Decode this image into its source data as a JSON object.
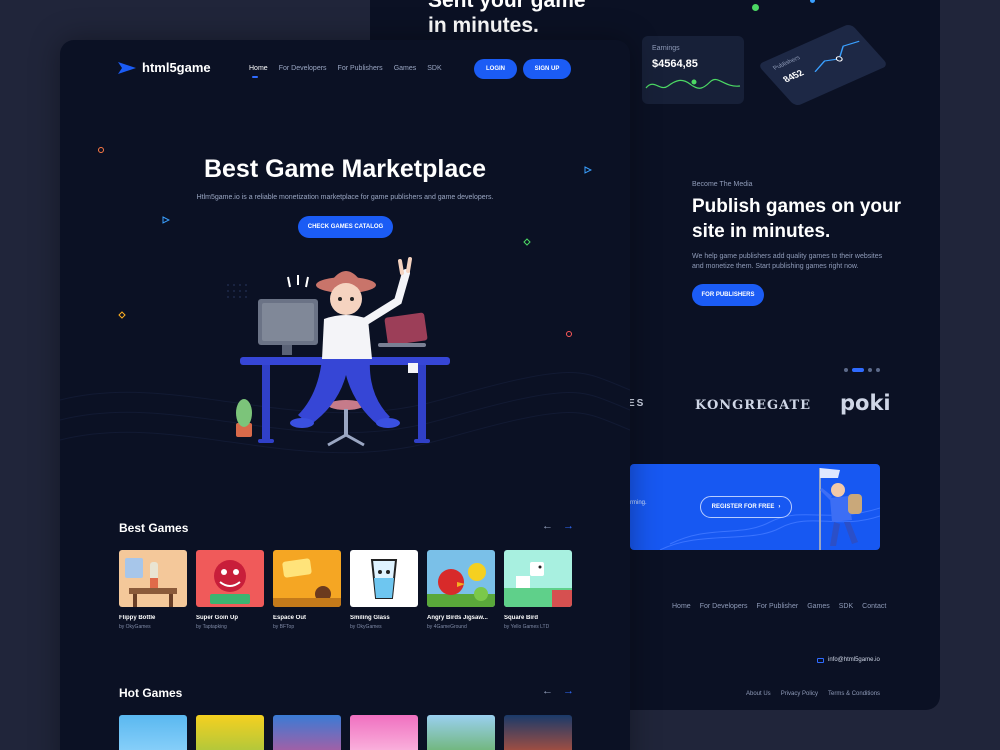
{
  "back": {
    "top_text_line1": "Sent your game",
    "top_text_line2": "in minutes.",
    "earnings": {
      "label": "Earnings",
      "value": "$4564,85"
    },
    "publishers_widget": {
      "label": "Publishers",
      "value": "8452"
    },
    "eyebrow": "Become The Media",
    "publish_title": "Publish games on your site in minutes.",
    "publish_desc": "We help game publishers add quality games to their websites and monetize them. Start publishing games right now.",
    "for_publishers_label": "FOR PUBLISHERS",
    "partners": {
      "partial": "ES",
      "kongregate": "KONGREGATE",
      "poki": "poki"
    },
    "cta_small": "rming.",
    "register_label": "REGISTER FOR FREE",
    "footer_nav": [
      "Home",
      "For Developers",
      "For Publisher",
      "Games",
      "SDK",
      "Contact"
    ],
    "email": "info@html5game.io",
    "footer_legal": [
      "About Us",
      "Privacy Policy",
      "Terms & Conditions"
    ]
  },
  "front": {
    "logo": "html5game",
    "nav": [
      "Home",
      "For Developers",
      "For Publishers",
      "Games",
      "SDK"
    ],
    "login_label": "LOGIN",
    "signup_label": "SIGN UP",
    "hero_title": "Best Game Marketplace",
    "hero_sub": "Htlm5game.io is a reliable monetization marketplace for game publishers and game developers.",
    "catalog_label": "CHECK GAMES CATALOG",
    "best_games_title": "Best Games",
    "hot_games_title": "Hot Games",
    "best_games": [
      {
        "name": "Flippy Bottle",
        "by": "by OkyGames"
      },
      {
        "name": "Super Goin Up",
        "by": "by Taptapking"
      },
      {
        "name": "Espace Out",
        "by": "by BFTop"
      },
      {
        "name": "Smiling Glass",
        "by": "by OkyGames"
      },
      {
        "name": "Angry Birds Jigsaw...",
        "by": "by 4GameGround"
      },
      {
        "name": "Square Bird",
        "by": "by Yello Games LTD"
      }
    ]
  },
  "colors": {
    "accent": "#1b5cf5",
    "bg_page": "#20253a",
    "bg_card": "#0b1124"
  }
}
